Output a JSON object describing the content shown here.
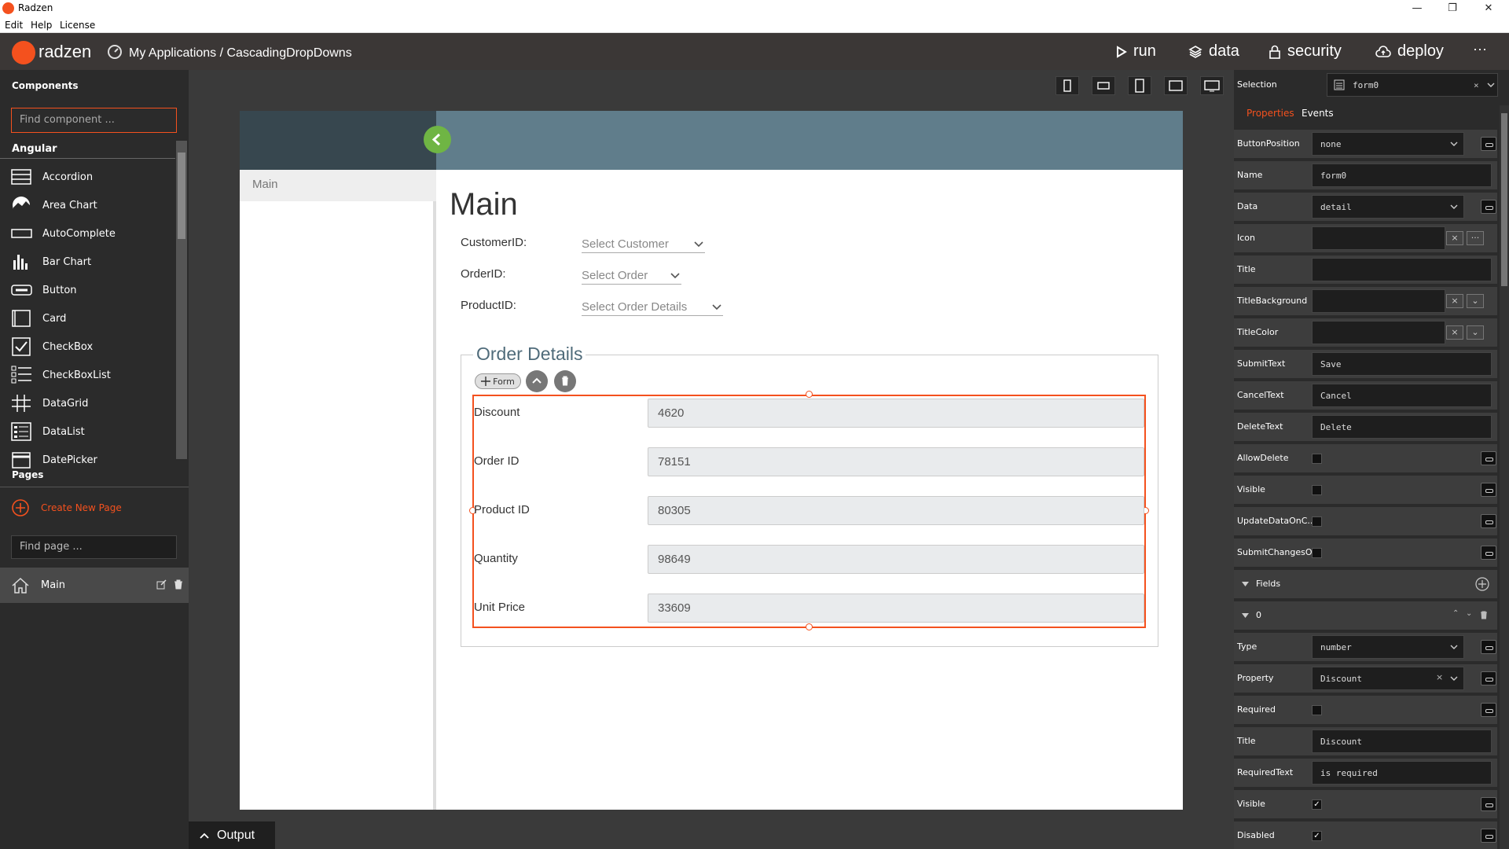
{
  "window": {
    "title": "Radzen",
    "minimize": "—",
    "restore": "❐",
    "close": "✕"
  },
  "menu": [
    "Edit",
    "Help",
    "License"
  ],
  "header": {
    "logo_text": "radzen",
    "breadcrumb": "My Applications / CascadingDropDowns",
    "nav": {
      "run": "run",
      "data": "data",
      "security": "security",
      "deploy": "deploy",
      "more": "···"
    }
  },
  "left": {
    "components_title": "Components",
    "find_component_placeholder": "Find component ...",
    "group": "Angular",
    "components": [
      "Accordion",
      "Area Chart",
      "AutoComplete",
      "Bar Chart",
      "Button",
      "Card",
      "CheckBox",
      "CheckBoxList",
      "DataGrid",
      "DataList",
      "DatePicker"
    ],
    "pages_title": "Pages",
    "create_page": "Create New Page",
    "find_page_placeholder": "Find page ...",
    "pages": [
      "Main"
    ]
  },
  "canvas": {
    "sidenav_item": "Main",
    "heading": "Main",
    "filters": [
      {
        "label": "CustomerID:",
        "placeholder": "Select Customer"
      },
      {
        "label": "OrderID:",
        "placeholder": "Select Order"
      },
      {
        "label": "ProductID:",
        "placeholder": "Select Order Details"
      }
    ],
    "fieldset_legend": "Order Details",
    "form_tag": "Form",
    "fields": [
      {
        "label": "Discount",
        "value": "4620"
      },
      {
        "label": "Order ID",
        "value": "78151"
      },
      {
        "label": "Product ID",
        "value": "80305"
      },
      {
        "label": "Quantity",
        "value": "98649"
      },
      {
        "label": "Unit Price",
        "value": "33609"
      }
    ],
    "output_tab": "Output"
  },
  "right": {
    "selection_label": "Selection",
    "selection_value": "form0",
    "tabs": {
      "properties": "Properties",
      "events": "Events"
    },
    "props": {
      "buttonposition": {
        "label": "ButtonPosition",
        "value": "none"
      },
      "name": {
        "label": "Name",
        "value": "form0"
      },
      "data": {
        "label": "Data",
        "value": "detail"
      },
      "icon": {
        "label": "Icon",
        "value": ""
      },
      "title": {
        "label": "Title",
        "value": ""
      },
      "titlebackground": {
        "label": "TitleBackground",
        "value": ""
      },
      "titlecolor": {
        "label": "TitleColor",
        "value": ""
      },
      "submittext": {
        "label": "SubmitText",
        "value": "Save"
      },
      "canceltext": {
        "label": "CancelText",
        "value": "Cancel"
      },
      "deletetext": {
        "label": "DeleteText",
        "value": "Delete"
      },
      "allowdelete": {
        "label": "AllowDelete"
      },
      "visible": {
        "label": "Visible"
      },
      "updatedata": {
        "label": "UpdateDataOnC..."
      },
      "submitchanges": {
        "label": "SubmitChangesO..."
      }
    },
    "fields_section": "Fields",
    "field0": {
      "index": "0",
      "type": {
        "label": "Type",
        "value": "number"
      },
      "property": {
        "label": "Property",
        "value": "Discount"
      },
      "required": {
        "label": "Required"
      },
      "title": {
        "label": "Title",
        "value": "Discount"
      },
      "requiredtext": {
        "label": "RequiredText",
        "value": "is required"
      },
      "visible": {
        "label": "Visible"
      },
      "disabled": {
        "label": "Disabled"
      }
    }
  },
  "colors": {
    "accent": "#f4511e",
    "header_bg": "#607d8b",
    "sidenav_dark": "#37474f",
    "toggle_green": "#6fb544"
  }
}
